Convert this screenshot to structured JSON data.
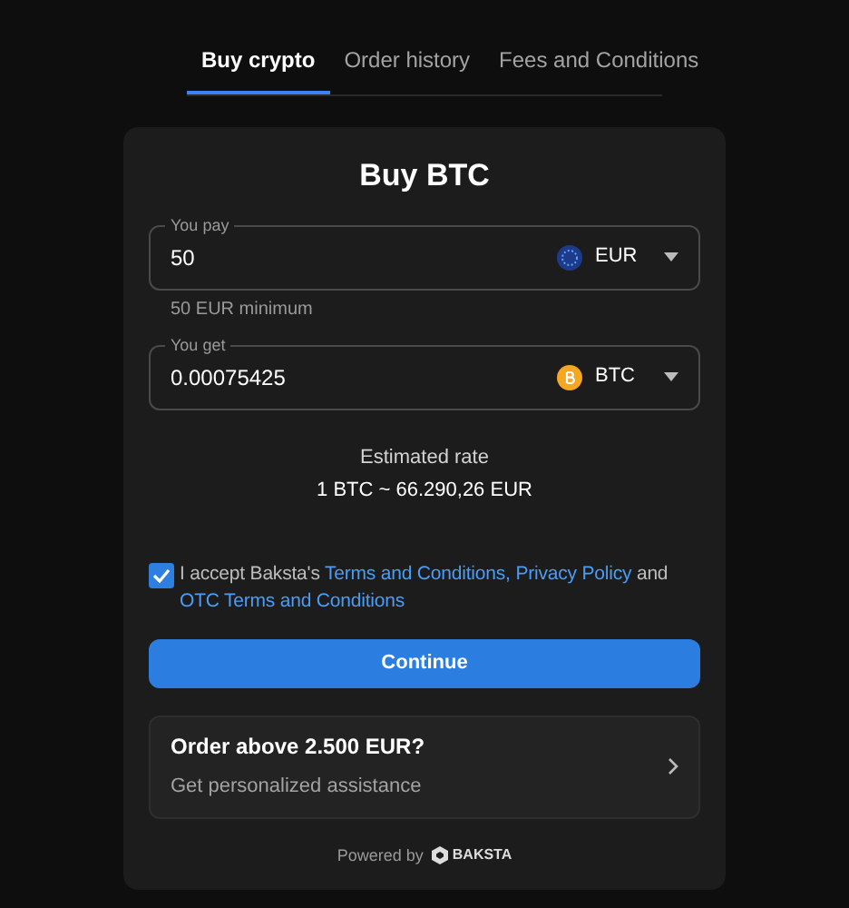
{
  "tabs": [
    {
      "label": "Buy crypto",
      "selected": true
    },
    {
      "label": "Order history",
      "selected": false
    },
    {
      "label": "Fees and Conditions",
      "selected": false
    }
  ],
  "card": {
    "title": "Buy BTC",
    "fields": [
      {
        "label": "You pay",
        "value": "50",
        "currency": "EUR",
        "kind": "eur",
        "hint": "50 EUR minimum"
      },
      {
        "label": "You get",
        "value": "0.00075425",
        "currency": "BTC",
        "kind": "btc"
      }
    ],
    "rate_label": "Estimated rate",
    "rate": "1 BTC ~ 66.290,26 EUR",
    "accept": {
      "checked": true,
      "parts": [
        {
          "kind": "text",
          "text": "I accept Baksta's "
        },
        {
          "kind": "link",
          "text": "Terms and Conditions,"
        },
        {
          "kind": "link",
          "text": "Privacy Policy"
        },
        {
          "kind": "text",
          "text": " and "
        },
        {
          "kind": "link",
          "text": "OTC Terms and Conditions"
        }
      ]
    },
    "continue_button": "Continue",
    "assist": {
      "title": "Order above 2.500 EUR?",
      "subtitle": "Get personalized assistance"
    },
    "footer": {
      "powered": "Powered by",
      "brand": "BAKSTA"
    }
  }
}
